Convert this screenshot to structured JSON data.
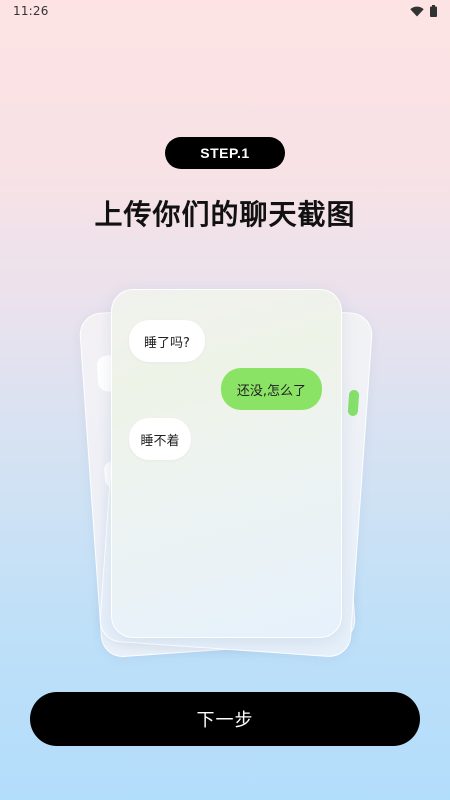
{
  "status_bar": {
    "time": "11:26",
    "icons": [
      "wifi-icon",
      "battery-icon"
    ]
  },
  "step": {
    "label": "STEP.1"
  },
  "title": "上传你们的聊天截图",
  "chat": {
    "messages": [
      {
        "side": "incoming",
        "text": "睡了吗?"
      },
      {
        "side": "outgoing",
        "text": "还没,怎么了"
      },
      {
        "side": "incoming",
        "text": "睡不着"
      }
    ]
  },
  "actions": {
    "next_label": "下一步"
  },
  "colors": {
    "accent_black": "#000000",
    "outgoing_bubble": "#8be366",
    "incoming_bubble": "#ffffff"
  }
}
